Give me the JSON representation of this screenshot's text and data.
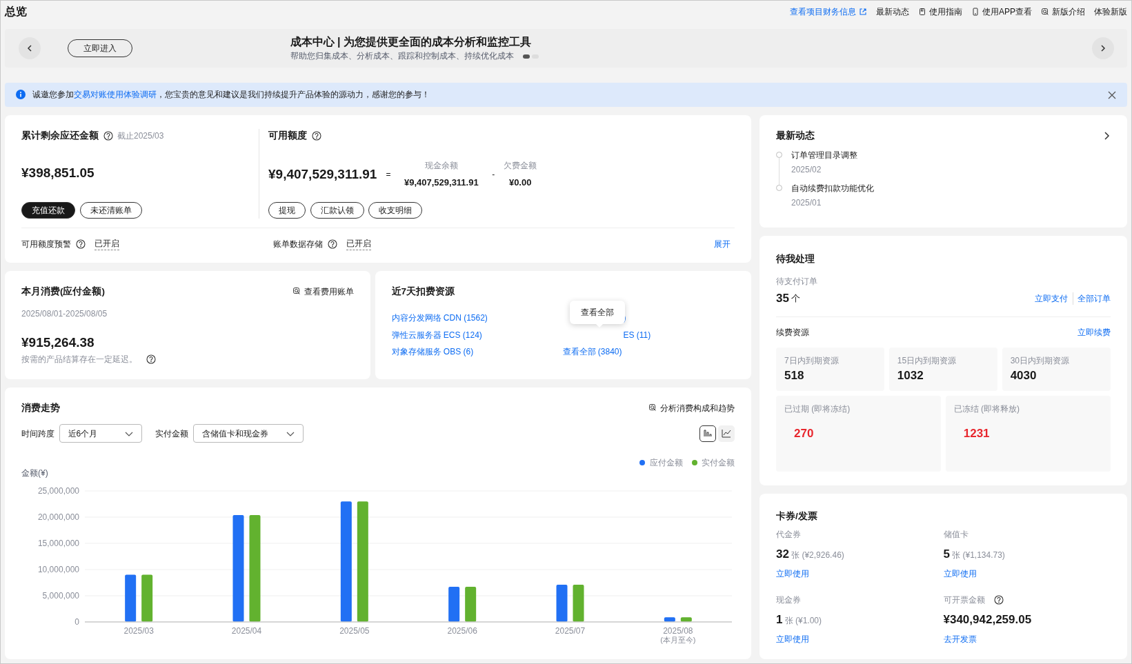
{
  "page_title": "总览",
  "header_links": [
    {
      "label": "查看项目财务信息",
      "kind": "external"
    },
    {
      "label": "最新动态",
      "kind": "plain"
    },
    {
      "label": "使用指南",
      "kind": "doc"
    },
    {
      "label": "使用APP查看",
      "kind": "phone"
    },
    {
      "label": "新版介绍",
      "kind": "search"
    },
    {
      "label": "体验新版",
      "kind": "plain"
    }
  ],
  "banner": {
    "button": "立即进入",
    "title": "成本中心 | 为您提供更全面的成本分析和监控工具",
    "subtitle": "帮助您归集成本、分析成本、跟踪和控制成本、持续优化成本",
    "dots": [
      {
        "selected": true
      },
      {
        "selected": false
      }
    ]
  },
  "notice": {
    "before": "诚邀您参加",
    "link": "交易对账使用体验调研",
    "after": "，您宝贵的意见和建议是我们持续提升产品体验的源动力，感谢您的参与！"
  },
  "balance": {
    "title": "累计剩余应还金额",
    "note": "截止2025/03",
    "amount": "¥398,851.05",
    "buttons": [
      {
        "label": "充值还款",
        "primary": true
      },
      {
        "label": "未还清账单",
        "primary": false
      }
    ]
  },
  "credit": {
    "title": "可用额度",
    "amount": "¥9,407,529,311.91",
    "equals": "=",
    "cash_label": "现金余额",
    "cash": "¥9,407,529,311.91",
    "minus": "-",
    "debt_label": "欠费金额",
    "debt": "¥0.00",
    "buttons": [
      "提现",
      "汇款认领",
      "收支明细"
    ]
  },
  "settings": [
    {
      "label": "可用额度预警",
      "value": "已开启"
    },
    {
      "label": "账单数据存储",
      "value": "已开启"
    }
  ],
  "expand": "展开",
  "month": {
    "title": "本月消费(应付金额)",
    "link": "查看费用账单",
    "range": "2025/08/01-2025/08/05",
    "amount": "¥915,264.38",
    "note": "按需的产品结算存在一定延迟。"
  },
  "resources": {
    "title": "近7天扣费资源",
    "links": [
      "内容分发网络 CDN (1562)",
      "弹性云服务器 ECS (124)",
      "对象存储服务 OBS (6)",
      ")",
      "ES (11)",
      "查看全部 (3840)"
    ],
    "tooltip": "查看全部"
  },
  "trend": {
    "title": "消费走势",
    "link": "分析消费构成和趋势",
    "filters": [
      {
        "label": "时间跨度",
        "value": "近6个月"
      },
      {
        "label": "实付金额",
        "value": "含储值卡和现金券"
      }
    ],
    "views": [
      {
        "kind": "bar",
        "selected": true
      },
      {
        "kind": "line",
        "selected": false
      }
    ],
    "chart_data": {
      "type": "bar",
      "grid": true,
      "ylabel": "金额(¥)",
      "categories": [
        "2025/03",
        "2025/04",
        "2025/05",
        "2025/06",
        "2025/07",
        "2025/08 (本月至今)"
      ],
      "ylim": [
        0,
        25000000
      ],
      "yticks": [
        {
          "value": 0,
          "label": "0"
        },
        {
          "value": 5000000,
          "label": "5,000,000"
        },
        {
          "value": 10000000,
          "label": "10,000,000"
        },
        {
          "value": 15000000,
          "label": "15,000,000"
        },
        {
          "value": 20000000,
          "label": "20,000,000"
        },
        {
          "value": 25000000,
          "label": "25,000,000"
        }
      ],
      "series": [
        {
          "name": "应付金额",
          "color": "#2170f4",
          "values": [
            9000000,
            20400000,
            23000000,
            6700000,
            7100000,
            900000
          ]
        },
        {
          "name": "实付金额",
          "color": "#62b22f",
          "values": [
            9000000,
            20400000,
            23000000,
            6700000,
            7100000,
            900000
          ]
        }
      ]
    }
  },
  "news": {
    "title": "最新动态",
    "items": [
      {
        "title": "订单管理目录调整",
        "date": "2025/02"
      },
      {
        "title": "自动续费扣款功能优化",
        "date": "2025/01"
      }
    ]
  },
  "todo": {
    "title": "待我处理",
    "pending_label": "待支付订单",
    "count": "35",
    "unit": "个",
    "actions": [
      "立即支付",
      "全部订单"
    ],
    "renew_title": "续费资源",
    "renew_link": "立即续费",
    "tiles": [
      {
        "label": "7日内到期资源",
        "value": "518",
        "alert": false
      },
      {
        "label": "15日内到期资源",
        "value": "1032",
        "alert": false
      },
      {
        "label": "30日内到期资源",
        "value": "4030",
        "alert": false
      },
      {
        "label": "已过期 (即将冻结)",
        "value": "270",
        "alert": true
      },
      {
        "label": "已冻结 (即将释放)",
        "value": "1231",
        "alert": true
      }
    ]
  },
  "vouchers": {
    "title": "卡券/发票",
    "items": [
      {
        "kind": "count",
        "label": "代金券",
        "count": "32",
        "unit": "张",
        "amount": "(¥2,926.46)",
        "link": "立即使用"
      },
      {
        "kind": "count",
        "label": "储值卡",
        "count": "5",
        "unit": "张",
        "amount": "(¥1,134.73)",
        "link": "立即使用"
      },
      {
        "kind": "count",
        "label": "现金券",
        "count": "1",
        "unit": "张",
        "amount": "(¥1.00)",
        "link": "立即使用"
      },
      {
        "kind": "amount",
        "label": "可开票金额",
        "value": "¥340,942,259.05",
        "link": "去开发票"
      }
    ]
  }
}
